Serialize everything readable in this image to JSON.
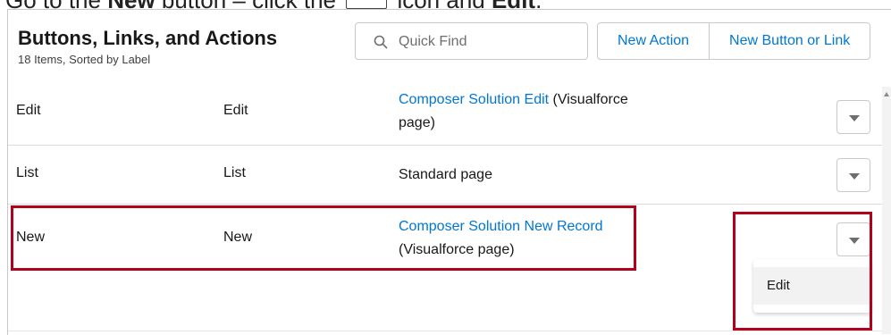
{
  "instruction": {
    "prefix": "Go to the ",
    "bold1": "New",
    "middle": " button – click the ",
    "after_icon": " icon and ",
    "bold2": "Edit",
    "suffix": "."
  },
  "header": {
    "title": "Buttons, Links, and Actions",
    "subtitle": "18 Items, Sorted by Label"
  },
  "search": {
    "placeholder": "Quick Find",
    "icon": "search-icon"
  },
  "actions": {
    "new_action_label": "New Action",
    "new_button_link_label": "New Button or Link"
  },
  "rows": [
    {
      "label": "Edit",
      "name": "Edit",
      "content_link": "Composer Solution Edit",
      "content_suffix": " (Visualforce page)",
      "content_plain": ""
    },
    {
      "label": "List",
      "name": "List",
      "content_link": "",
      "content_suffix": "",
      "content_plain": "Standard page"
    },
    {
      "label": "New",
      "name": "New",
      "content_link": "Composer Solution New Record",
      "content_suffix": " (Visualforce page)",
      "content_plain": ""
    }
  ],
  "row_menu": {
    "items": [
      "Edit"
    ]
  },
  "colors": {
    "link": "#0176d3",
    "highlight": "#b3001b",
    "border": "#c9c9c9"
  }
}
